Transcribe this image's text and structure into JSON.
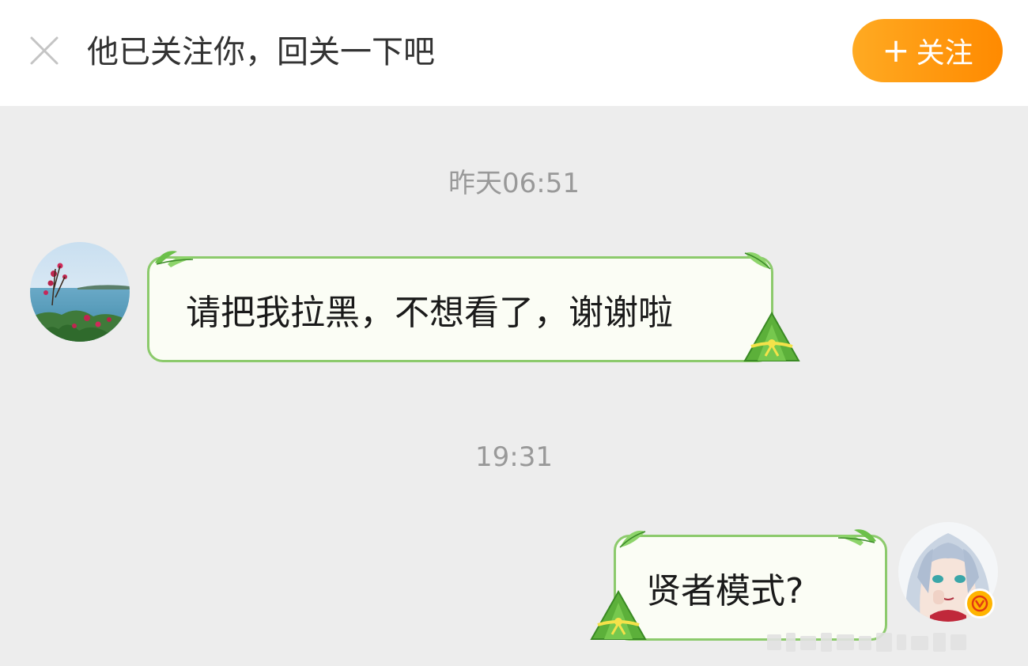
{
  "header": {
    "close_icon": "close-icon",
    "hint_text": "他已关注你，回关一下吧",
    "follow_button": {
      "plus": "+",
      "label": "关注"
    },
    "accent_color": "#ff9a12"
  },
  "messages": [
    {
      "time": "昨天06:51",
      "sender": "other",
      "text": "请把我拉黑，不想看了，谢谢啦"
    },
    {
      "time": "19:31",
      "sender": "self",
      "text": "贤者模式?",
      "verified_badge": "V"
    }
  ],
  "bubble_theme": {
    "border_color": "#8cca6c",
    "background": "#fbfdf5",
    "decorations": [
      "leaf-icon",
      "zongzi-icon"
    ]
  }
}
